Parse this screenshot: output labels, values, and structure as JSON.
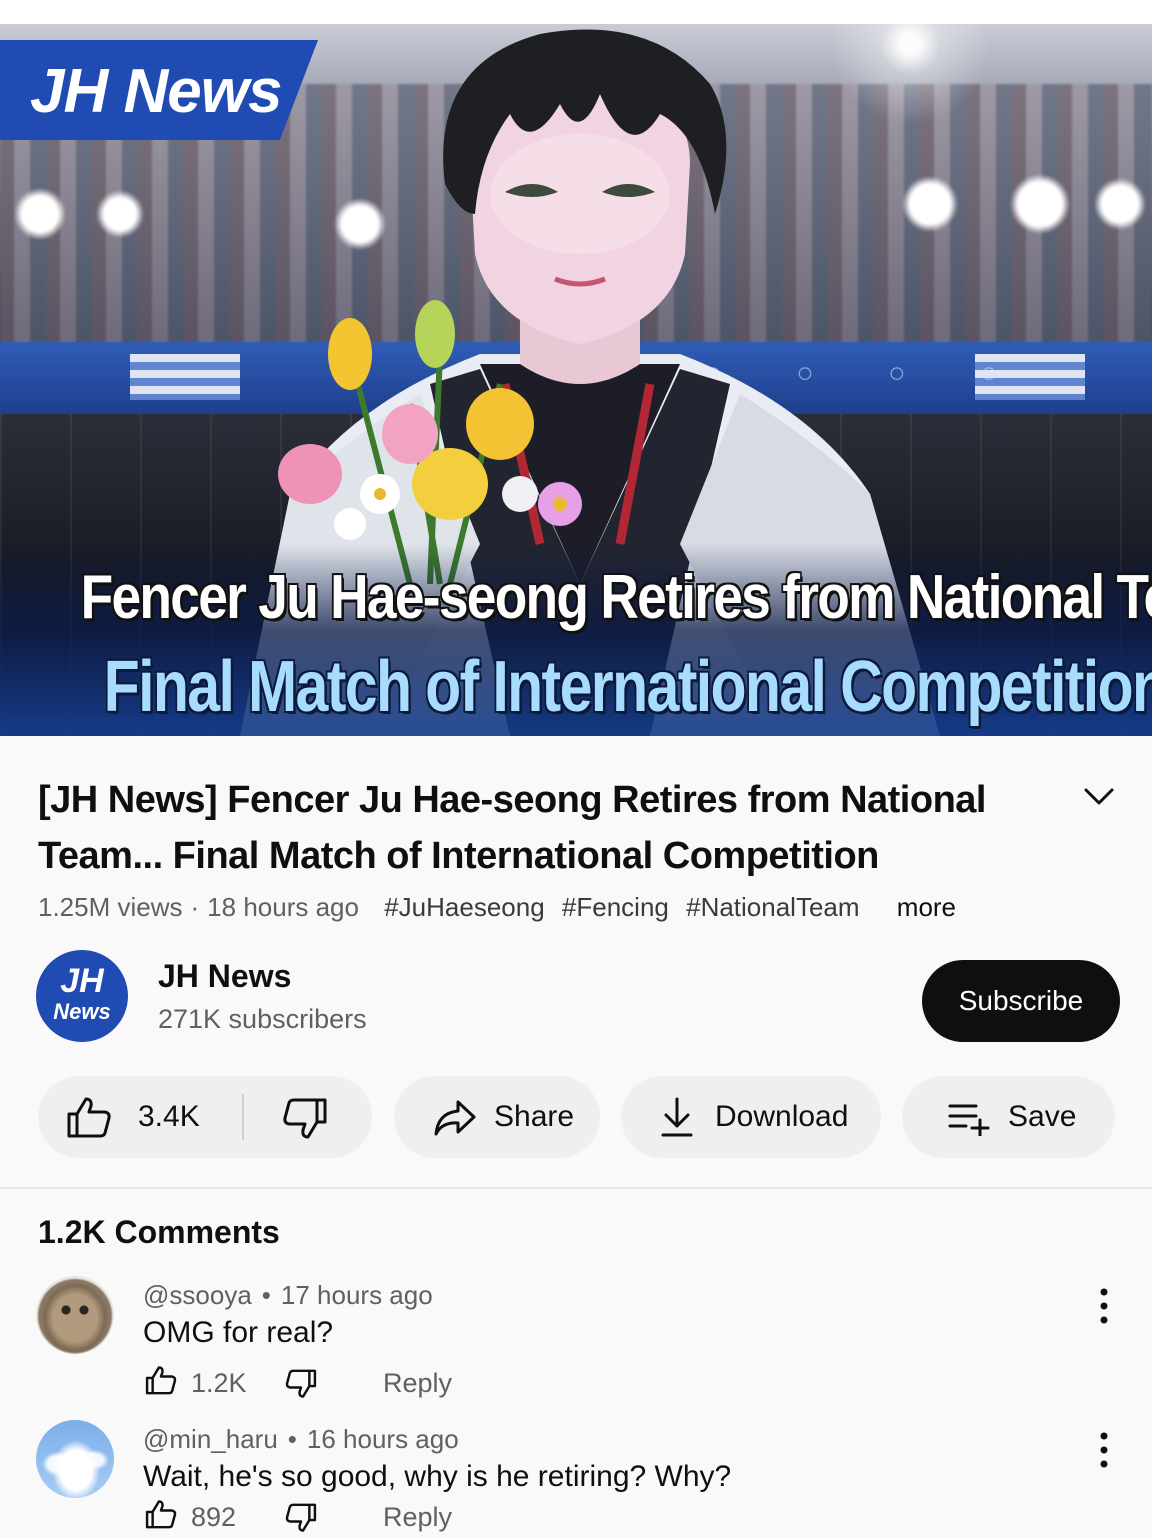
{
  "video": {
    "channel_tag": "JH News",
    "headline_line1": "Fencer Ju Hae-seong Retires from National Team",
    "headline_line2": "Final Match of International Competition"
  },
  "title": "[JH News] Fencer Ju Hae-seong Retires from National Team... Final Match of International Competition",
  "meta": {
    "views": "1.25M views",
    "time": "18 hours ago",
    "hashtags": [
      "#JuHaeseong",
      "#Fencing",
      "#NationalTeam"
    ],
    "more": "more"
  },
  "channel": {
    "avatar_line1": "JH",
    "avatar_line2": "News",
    "name": "JH News",
    "subscribers": "271K subscribers",
    "subscribe_label": "Subscribe"
  },
  "actions": {
    "likes": "3.4K",
    "share": "Share",
    "download": "Download",
    "save": "Save"
  },
  "comments": {
    "header": "1.2K Comments",
    "items": [
      {
        "author": "@ssooya",
        "time": "17 hours ago",
        "text": "OMG for real?",
        "likes": "1.2K",
        "reply": "Reply",
        "avatar": "cat-photo"
      },
      {
        "author": "@min_haru",
        "time": "16 hours ago",
        "text": "Wait, he's so good, why is he retiring? Why?",
        "likes": "892",
        "reply": "Reply",
        "avatar": "sky-photo"
      }
    ]
  },
  "colors": {
    "brand_blue": "#1f4bb3",
    "subscribe_bg": "#0f0f0f",
    "pill_bg": "#efefef",
    "secondary_text": "#606060"
  },
  "icons": [
    "thumbs-up-icon",
    "thumbs-down-icon",
    "share-arrow-icon",
    "download-icon",
    "save-playlist-icon",
    "chevron-down-icon",
    "more-vert-icon"
  ]
}
